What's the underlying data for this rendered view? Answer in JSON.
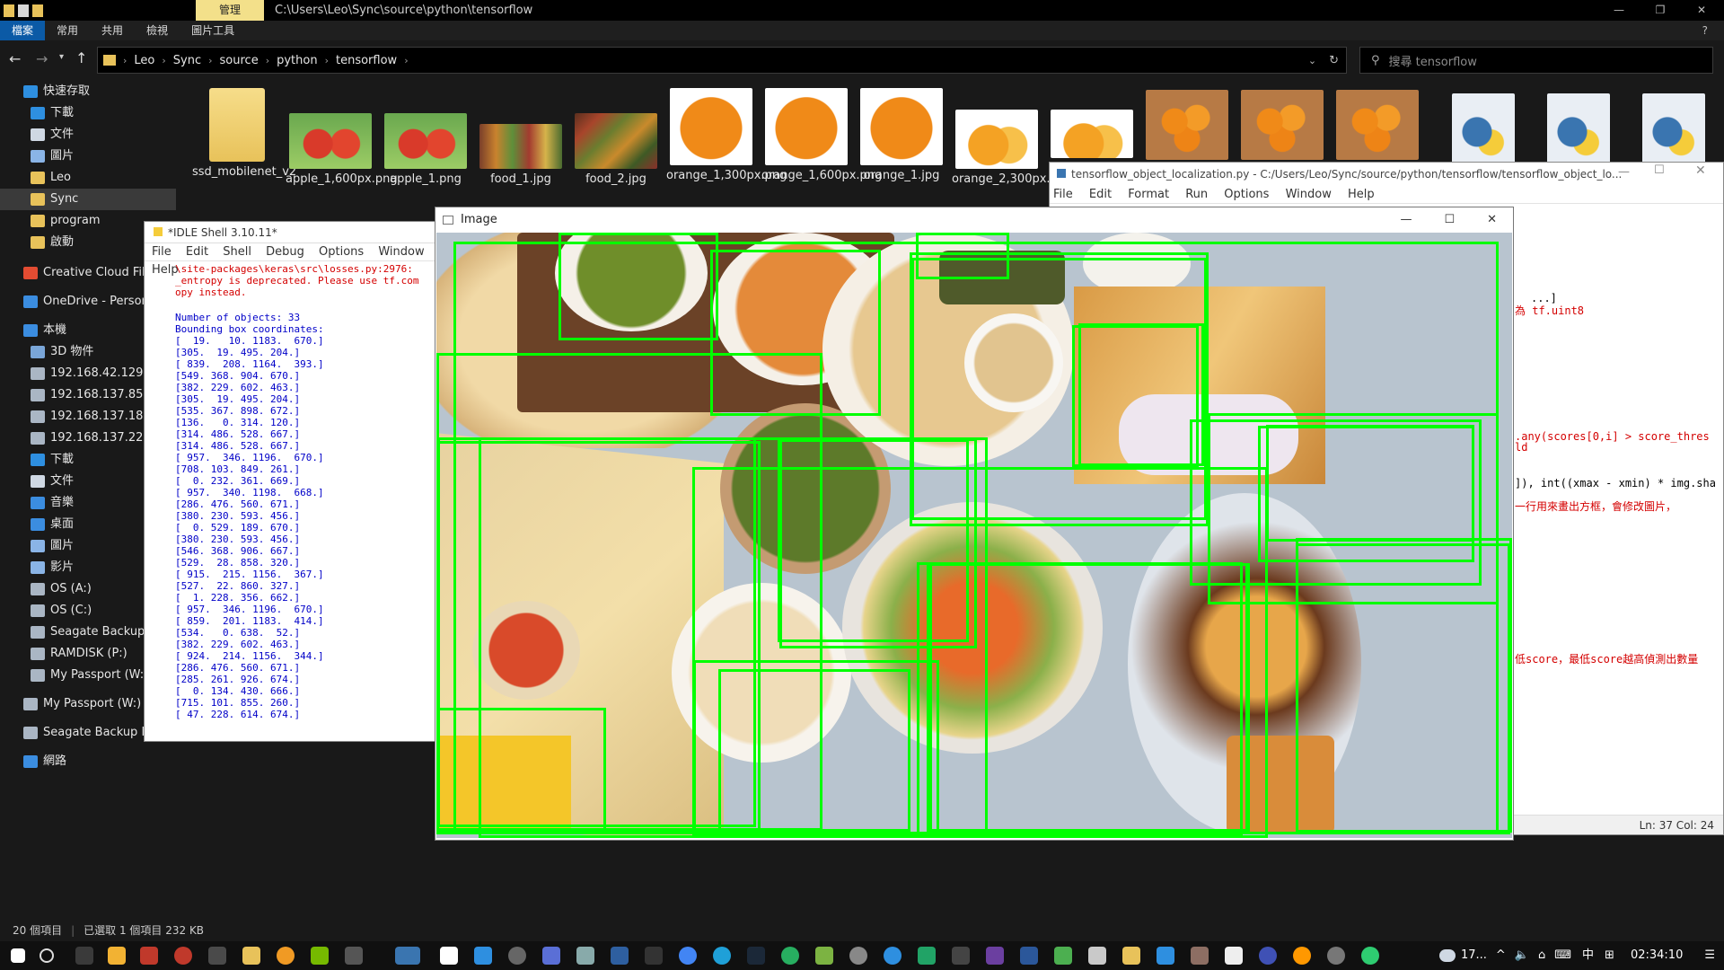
{
  "explorer": {
    "context_tab": "管理",
    "title_path": "C:\\Users\\Leo\\Sync\\source\\python\\tensorflow",
    "ribbon_tabs": [
      "檔案",
      "常用",
      "共用",
      "檢視",
      "圖片工具"
    ],
    "breadcrumbs": [
      "Leo",
      "Sync",
      "source",
      "python",
      "tensorflow"
    ],
    "search_placeholder": "搜尋 tensorflow",
    "status_left": "20 個項目",
    "status_sel": "已選取 1 個項目 232 KB"
  },
  "nav": [
    {
      "label": "快速存取",
      "color": "#2e8fe0"
    },
    {
      "label": "下載",
      "color": "#2e8fe0"
    },
    {
      "label": "文件",
      "color": "#cfd8e3"
    },
    {
      "label": "圖片",
      "color": "#8ab4e6"
    },
    {
      "label": "Leo",
      "color": "#e8c25a"
    },
    {
      "label": "Sync",
      "color": "#e8c25a"
    },
    {
      "label": "program",
      "color": "#e8c25a"
    },
    {
      "label": "啟動",
      "color": "#e8c25a"
    },
    {
      "label": "Creative Cloud Files",
      "color": "#e34c32"
    },
    {
      "label": "OneDrive - Personal",
      "color": "#3b8de0"
    },
    {
      "label": "本機",
      "color": "#3b8de0"
    },
    {
      "label": "3D 物件",
      "color": "#7aa6d8"
    },
    {
      "label": "192.168.42.129",
      "color": "#aab6c4"
    },
    {
      "label": "192.168.137.85",
      "color": "#aab6c4"
    },
    {
      "label": "192.168.137.186",
      "color": "#aab6c4"
    },
    {
      "label": "192.168.137.229",
      "color": "#aab6c4"
    },
    {
      "label": "下載",
      "color": "#2e8fe0"
    },
    {
      "label": "文件",
      "color": "#cfd8e3"
    },
    {
      "label": "音樂",
      "color": "#3b8de0"
    },
    {
      "label": "桌面",
      "color": "#3b8de0"
    },
    {
      "label": "圖片",
      "color": "#8ab4e6"
    },
    {
      "label": "影片",
      "color": "#8ab4e6"
    },
    {
      "label": "OS (A:)",
      "color": "#aab6c4"
    },
    {
      "label": "OS (C:)",
      "color": "#aab6c4"
    },
    {
      "label": "Seagate Backup Plu",
      "color": "#aab6c4"
    },
    {
      "label": "RAMDISK (P:)",
      "color": "#aab6c4"
    },
    {
      "label": "My Passport (W:)",
      "color": "#aab6c4"
    },
    {
      "label": "My Passport (W:)",
      "color": "#aab6c4"
    },
    {
      "label": "Seagate Backup Plus",
      "color": "#aab6c4"
    },
    {
      "label": "網路",
      "color": "#3b8de0"
    }
  ],
  "files": [
    {
      "label": "ssd_mobilenet_v2",
      "kind": "folder"
    },
    {
      "label": "apple_1,600px.png",
      "kind": "apple"
    },
    {
      "label": "apple_1.png",
      "kind": "apple"
    },
    {
      "label": "food_1.jpg",
      "kind": "food"
    },
    {
      "label": "food_2.jpg",
      "kind": "food2"
    },
    {
      "label": "orange_1,300px.png",
      "kind": "orange"
    },
    {
      "label": "orange_1,600px.png",
      "kind": "orange"
    },
    {
      "label": "orange_1.jpg",
      "kind": "orange"
    },
    {
      "label": "orange_2,300px.png",
      "kind": "orange2"
    },
    {
      "label": "",
      "kind": "orange2"
    },
    {
      "label": "",
      "kind": "orange3"
    },
    {
      "label": "",
      "kind": "orange3"
    },
    {
      "label": "",
      "kind": "orange3"
    },
    {
      "label": "",
      "kind": "py"
    },
    {
      "label": "",
      "kind": "py"
    },
    {
      "label": "",
      "kind": "py"
    }
  ],
  "idle": {
    "title": "*IDLE Shell 3.10.11*",
    "menu": [
      "File",
      "Edit",
      "Shell",
      "Debug",
      "Options",
      "Window",
      "Help"
    ],
    "warning": "\\site-packages\\keras\\src\\losses.py:2976: \n_entropy is deprecated. Please use tf.com\nopy instead.",
    "output": "Number of objects: 33\nBounding box coordinates:\n[  19.   10. 1183.  670.]\n[305.  19. 495. 204.]\n[ 839.  208. 1164.  393.]\n[549. 368. 904. 670.]\n[382. 229. 602. 463.]\n[305.  19. 495. 204.]\n[535. 367. 898. 672.]\n[136.   0. 314. 120.]\n[314. 486. 528. 667.]\n[314. 486. 528. 667.]\n[ 957.  346. 1196.  670.]\n[708. 103. 849. 261.]\n[  0. 232. 361. 669.]\n[ 957.  340. 1198.  668.]\n[286. 476. 560. 671.]\n[380. 230. 593. 456.]\n[  0. 529. 189. 670.]\n[380. 230. 593. 456.]\n[546. 368. 906. 667.]\n[529.  28. 858. 320.]\n[ 915.  215. 1156.  367.]\n[527.  22. 860. 327.]\n[  1. 228. 356. 662.]\n[ 957.  346. 1196.  670.]\n[ 859.  201. 1183.  414.]\n[534.   0. 638.  52.]\n[382. 229. 602. 463.]\n[ 924.  214. 1156.  344.]\n[286. 476. 560. 671.]\n[285. 261. 926. 674.]\n[  0. 134. 430. 666.]\n[715. 101. 855. 260.]\n[ 47. 228. 614. 674.]"
  },
  "editor": {
    "title": "tensorflow_object_localization.py - C:/Users/Leo/Sync/source/python/tensorflow/tensorflow_object_lo...",
    "menu": [
      "File",
      "Edit",
      "Format",
      "Run",
      "Options",
      "Window",
      "Help"
    ],
    "frag1": "...]",
    "frag2": "為 tf.uint8",
    "frag3": ".any(scores[0,i] > score_thres",
    "frag3b": "ld",
    "frag4": "]), int((xmax - xmin) * img.sha",
    "frag5": "一行用來畫出方框，會修改圖片，",
    "frag6": "低score，最低score越高偵測出數量",
    "status": "Ln: 37   Col: 24"
  },
  "imagewin": {
    "title": "Image"
  },
  "taskbar": {
    "weather": "17...",
    "ime": "中",
    "time": "02:34:10"
  }
}
